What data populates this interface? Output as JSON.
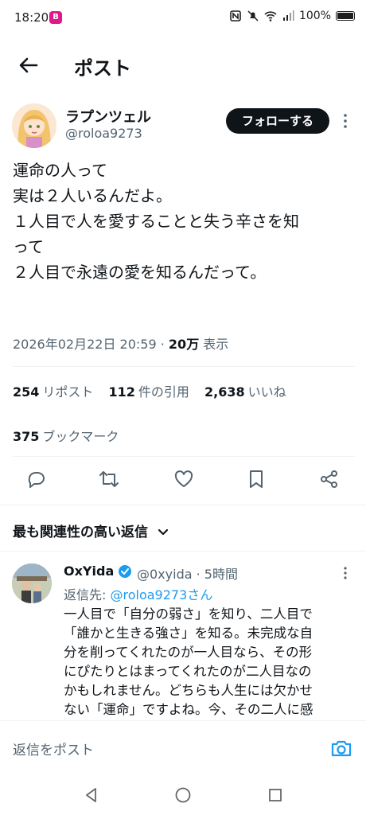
{
  "status_bar": {
    "time": "18:20",
    "app_badge": "B",
    "battery": "100%"
  },
  "header": {
    "title": "ポスト"
  },
  "tweet": {
    "author_name": "ラプンツェル",
    "author_handle": "@roloa9273",
    "follow_label": "フォローする",
    "body_lines": [
      "運命の人って",
      "実は２人いるんだよ。",
      "",
      "１人目で人を愛することと失う辛さを知",
      "って",
      "２人目で永遠の愛を知るんだって。"
    ],
    "timestamp": "2026年02月22日 20:59",
    "separator": "·",
    "views_count": "20万",
    "views_label": "表示",
    "reposts_count": "254",
    "reposts_label": "リポスト",
    "quotes_count": "112",
    "quotes_label": "件の引用",
    "likes_count": "2,638",
    "likes_label": "いいね",
    "bookmarks_count": "375",
    "bookmarks_label": "ブックマーク"
  },
  "replies": {
    "heading": "最も関連性の高い返信",
    "items": [
      {
        "name": "OxYida",
        "handle": "@0xyida",
        "time": "· 5時間",
        "reply_to_prefix": "返信先: ",
        "reply_to_link": "@roloa9273さん",
        "body_lines": [
          "一人目で「自分の弱さ」を知り、二人目で",
          "「誰かと生きる強さ」を知る。未完成な自",
          "分を削ってくれたのが一人目なら、その形",
          "にぴたりとはまってくれたのが二人目なの",
          "かもしれません。どちらも人生には欠かせ",
          "ない「運命」ですよね。今、その二人に感"
        ]
      }
    ]
  },
  "compose": {
    "placeholder": "返信をポスト"
  },
  "colors": {
    "link": "#1d9bf0",
    "secondary_text": "#536471",
    "primary_text": "#0f1419"
  }
}
